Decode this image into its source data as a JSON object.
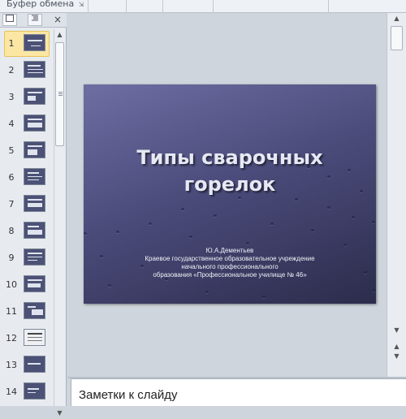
{
  "ribbon": {
    "group_label": "Буфер обмена"
  },
  "left_panel": {
    "tabs": [
      {
        "name": "slides-tab",
        "icon": "slide-icon"
      },
      {
        "name": "outline-tab",
        "icon": "outline-icon"
      }
    ],
    "close_icon": "×",
    "slides": [
      {
        "num": "1",
        "selected": true
      },
      {
        "num": "2"
      },
      {
        "num": "3"
      },
      {
        "num": "4"
      },
      {
        "num": "5"
      },
      {
        "num": "6"
      },
      {
        "num": "7"
      },
      {
        "num": "8"
      },
      {
        "num": "9"
      },
      {
        "num": "10"
      },
      {
        "num": "11"
      },
      {
        "num": "12"
      },
      {
        "num": "13"
      },
      {
        "num": "14"
      }
    ]
  },
  "slide": {
    "title_line1": "Типы сварочных",
    "title_line2": "горелок",
    "author": "Ю.А.Дементьев",
    "org_line1": "Краевое государственное образовательное учреждение",
    "org_line2": "начального профессионального",
    "org_line3": "образования «Профессиональное училище № 46»"
  },
  "notes": {
    "placeholder": "Заметки к слайду"
  },
  "colors": {
    "selected_thumb": "#fbe7a3",
    "slide_bg": "#4c4c7c"
  }
}
